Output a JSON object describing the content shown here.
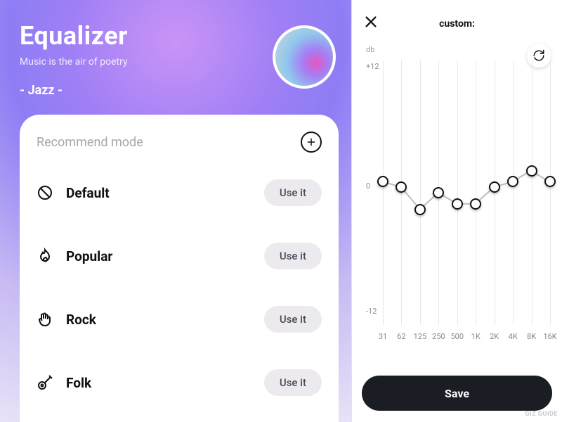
{
  "header": {
    "title": "Equalizer",
    "subtitle": "Music is the air of poetry",
    "current_mode_label": "- Jazz -"
  },
  "card": {
    "heading": "Recommend mode",
    "use_label": "Use it",
    "modes": [
      {
        "icon": "ban-icon",
        "name": "Default"
      },
      {
        "icon": "flame-icon",
        "name": "Popular"
      },
      {
        "icon": "rock-icon",
        "name": "Rock"
      },
      {
        "icon": "guitar-icon",
        "name": "Folk"
      }
    ]
  },
  "panel": {
    "title": "custom:",
    "db_label": "db",
    "ticks_plus": "+12",
    "ticks_zero": "0",
    "ticks_minus": "-12",
    "save_label": "Save"
  },
  "watermark": "GIZ GUIDE",
  "chart_data": {
    "type": "line",
    "title": "custom:",
    "xlabel": "",
    "ylabel": "db",
    "ylim": [
      -12,
      12
    ],
    "categories": [
      "31",
      "62",
      "125",
      "250",
      "500",
      "1K",
      "2K",
      "4K",
      "8K",
      "16K"
    ],
    "values": [
      1,
      0.5,
      -1.5,
      0,
      -1,
      -1,
      0.5,
      1,
      2,
      1
    ]
  }
}
